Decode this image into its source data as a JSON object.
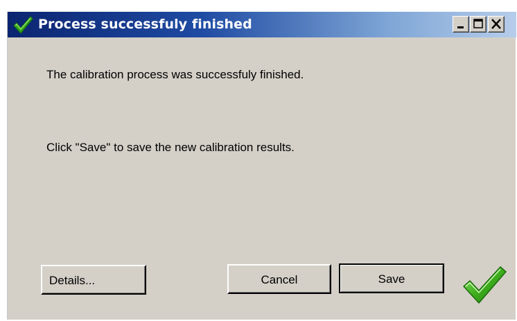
{
  "window": {
    "title": "Process successfuly finished",
    "title_icon": "green-check-icon",
    "controls": {
      "minimize_icon": "minimize-icon",
      "maximize_icon": "maximize-icon",
      "close_icon": "close-icon"
    }
  },
  "content": {
    "message_1": "The calibration process was successfuly finished.",
    "message_2": "Click \"Save\" to save the new calibration results."
  },
  "buttons": {
    "details_label": "Details...",
    "cancel_label": "Cancel",
    "save_label": "Save"
  },
  "status_icon": "success-check-icon",
  "colors": {
    "titlebar_start": "#0b2470",
    "titlebar_end": "#b6cdea",
    "window_bg": "#d4d0c8",
    "check_green": "#3fae1e"
  }
}
